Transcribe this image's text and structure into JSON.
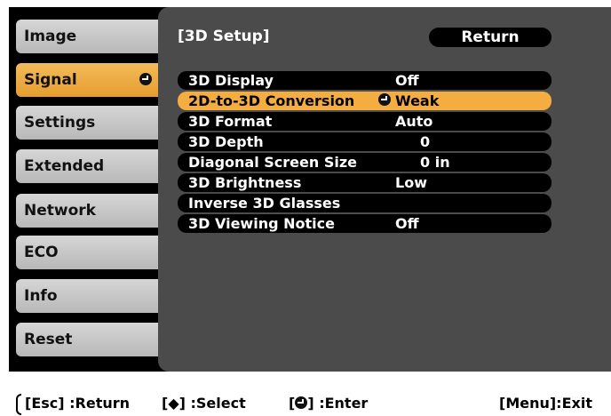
{
  "sidebar": {
    "items": [
      {
        "label": "Image"
      },
      {
        "label": "Signal"
      },
      {
        "label": "Settings"
      },
      {
        "label": "Extended"
      },
      {
        "label": "Network"
      },
      {
        "label": "ECO"
      },
      {
        "label": "Info"
      },
      {
        "label": "Reset"
      }
    ],
    "active_index": 1
  },
  "panel": {
    "title": "[3D Setup]",
    "return_label": "Return"
  },
  "settings": [
    {
      "label": "3D Display",
      "value": "Off"
    },
    {
      "label": "2D-to-3D Conversion",
      "value": "Weak",
      "selected": true
    },
    {
      "label": "3D Format",
      "value": "Auto"
    },
    {
      "label": "3D Depth",
      "value": "0"
    },
    {
      "label": "Diagonal Screen Size",
      "value": "0 in"
    },
    {
      "label": "3D Brightness",
      "value": "Low"
    },
    {
      "label": "Inverse 3D Glasses",
      "value": ""
    },
    {
      "label": "3D Viewing Notice",
      "value": "Off"
    }
  ],
  "footer": {
    "esc_hint": "[Esc] :Return",
    "select_hint": "[◆] :Select",
    "enter_key_open": "[",
    "enter_key_close": "] :Enter",
    "menu_hint": "[Menu]:Exit"
  },
  "colors": {
    "accent": "#f3ad40",
    "nav_bg": "#c8c8c8",
    "panel_bg": "#4b4b4b",
    "row_bg": "#000000"
  },
  "icons": {
    "enter": "enter-icon"
  }
}
